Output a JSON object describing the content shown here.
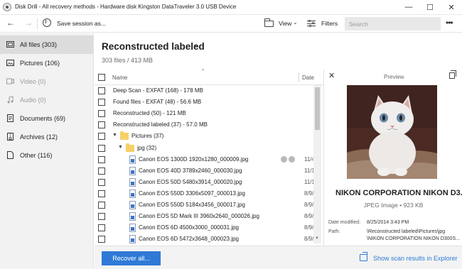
{
  "window": {
    "title": "Disk Drill - All recovery methods - Hardware disk Kingston DataTraveler 3.0 USB Device",
    "minimize": "—",
    "maximize": "☐",
    "close": "✕"
  },
  "toolbar": {
    "back": "←",
    "forward": "→",
    "save_label": "Save session as...",
    "view_label": "View",
    "view_caret": "⌄",
    "filters_label": "Filters",
    "search_placeholder": "Search",
    "more": "•••"
  },
  "sidebar": {
    "items": [
      {
        "label": "All files (303)",
        "icon": "all-files-icon",
        "active": true
      },
      {
        "label": "Pictures (106)",
        "icon": "pictures-icon"
      },
      {
        "label": "Video (0)",
        "icon": "video-icon",
        "disabled": true
      },
      {
        "label": "Audio (0)",
        "icon": "audio-icon",
        "disabled": true
      },
      {
        "label": "Documents (69)",
        "icon": "documents-icon"
      },
      {
        "label": "Archives (12)",
        "icon": "archives-icon"
      },
      {
        "label": "Other (116)",
        "icon": "other-icon"
      }
    ]
  },
  "main": {
    "title": "Reconstructed labeled",
    "title_caret": "⌄",
    "subtitle": "303 files / 413 MB",
    "col_name": "Name",
    "col_sort": "^",
    "col_date": "Date",
    "groups": [
      {
        "label": "Deep Scan - EXFAT (168) - 178 MB",
        "arrow": "▶"
      },
      {
        "label": "Found files - EXFAT (48) - 56.6 MB",
        "arrow": "▶"
      },
      {
        "label": "Reconstructed (50) - 121 MB",
        "arrow": "▶"
      },
      {
        "label": "Reconstructed labeled (37) - 57.0 MB",
        "arrow": "▼"
      }
    ],
    "folders": [
      {
        "label": "Pictures (37)",
        "arrow": "▼"
      },
      {
        "label": "jpg (32)",
        "arrow": "▼"
      }
    ],
    "files": [
      {
        "name": "Canon EOS 1300D 1920x1280_000009.jpg",
        "date": "11/4"
      },
      {
        "name": "Canon EOS 40D 3789x2460_000030.jpg",
        "date": "11/1"
      },
      {
        "name": "Canon EOS 50D 5480x3914_000020.jpg",
        "date": "11/1"
      },
      {
        "name": "Canon EOS 550D 3306x5097_000013.jpg",
        "date": "8/9/"
      },
      {
        "name": "Canon EOS 550D 5184x3456_000017.jpg",
        "date": "8/9/"
      },
      {
        "name": "Canon EOS 5D Mark III 3960x2640_000026.jpg",
        "date": "8/9/"
      },
      {
        "name": "Canon EOS 6D 4500x3000_000031.jpg",
        "date": "8/9/"
      },
      {
        "name": "Canon EOS 6D 5472x3648_000023.jpg",
        "date": "8/9/"
      }
    ]
  },
  "preview": {
    "close": "✕",
    "title": "Preview",
    "filename": "NIKON CORPORATION NIKON D3...",
    "meta": "JPEG Image • 923 KB",
    "date_modified_label": "Date modified:",
    "date_modified_value": "8/25/2014 3:43 PM",
    "path_label": "Path:",
    "path_line1": "\\Reconstructed labeled\\Pictures\\jpg",
    "path_line2": "\\NIKON CORPORATION NIKON D300S..."
  },
  "bottom": {
    "recover_label": "Recover all...",
    "explorer_label": "Show scan results in Explorer"
  },
  "colors": {
    "accent": "#2f7ad6",
    "folder": "#f7d068",
    "sidebar_bg": "#f2f2f2",
    "sidebar_active": "#dcdcdc"
  }
}
